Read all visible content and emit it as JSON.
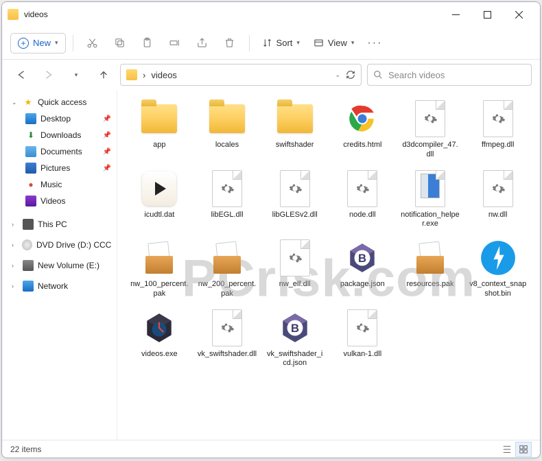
{
  "window": {
    "title": "videos"
  },
  "toolbar": {
    "new_label": "New",
    "sort_label": "Sort",
    "view_label": "View"
  },
  "breadcrumb": {
    "current": "videos",
    "sep": "›"
  },
  "search": {
    "placeholder": "Search videos"
  },
  "sidebar": {
    "quick_access": "Quick access",
    "items": [
      {
        "label": "Desktop",
        "icon": "desktop",
        "pinned": true
      },
      {
        "label": "Downloads",
        "icon": "downloads",
        "pinned": true
      },
      {
        "label": "Documents",
        "icon": "documents",
        "pinned": true
      },
      {
        "label": "Pictures",
        "icon": "pictures",
        "pinned": true
      },
      {
        "label": "Music",
        "icon": "music",
        "pinned": false
      },
      {
        "label": "Videos",
        "icon": "videos",
        "pinned": false
      }
    ],
    "this_pc": "This PC",
    "dvd": "DVD Drive (D:) CCCC",
    "new_volume": "New Volume (E:)",
    "network": "Network"
  },
  "files": [
    {
      "name": "app",
      "type": "folder"
    },
    {
      "name": "locales",
      "type": "folder"
    },
    {
      "name": "swiftshader",
      "type": "folder"
    },
    {
      "name": "credits.html",
      "type": "chrome"
    },
    {
      "name": "d3dcompiler_47.dll",
      "type": "dll"
    },
    {
      "name": "ffmpeg.dll",
      "type": "dll"
    },
    {
      "name": "icudtl.dat",
      "type": "dat"
    },
    {
      "name": "libEGL.dll",
      "type": "dll"
    },
    {
      "name": "libGLESv2.dll",
      "type": "dll"
    },
    {
      "name": "node.dll",
      "type": "dll"
    },
    {
      "name": "notification_helper.exe",
      "type": "notif"
    },
    {
      "name": "nw.dll",
      "type": "dll"
    },
    {
      "name": "nw_100_percent.pak",
      "type": "pak"
    },
    {
      "name": "nw_200_percent.pak",
      "type": "pak"
    },
    {
      "name": "nw_elf.dll",
      "type": "dll"
    },
    {
      "name": "package.json",
      "type": "json"
    },
    {
      "name": "resources.pak",
      "type": "pak"
    },
    {
      "name": "v8_context_snapshot.bin",
      "type": "bin"
    },
    {
      "name": "videos.exe",
      "type": "exe"
    },
    {
      "name": "vk_swiftshader.dll",
      "type": "dll"
    },
    {
      "name": "vk_swiftshader_icd.json",
      "type": "json"
    },
    {
      "name": "vulkan-1.dll",
      "type": "dll"
    }
  ],
  "status": {
    "count": "22 items"
  },
  "watermark": "PCrisk.com"
}
